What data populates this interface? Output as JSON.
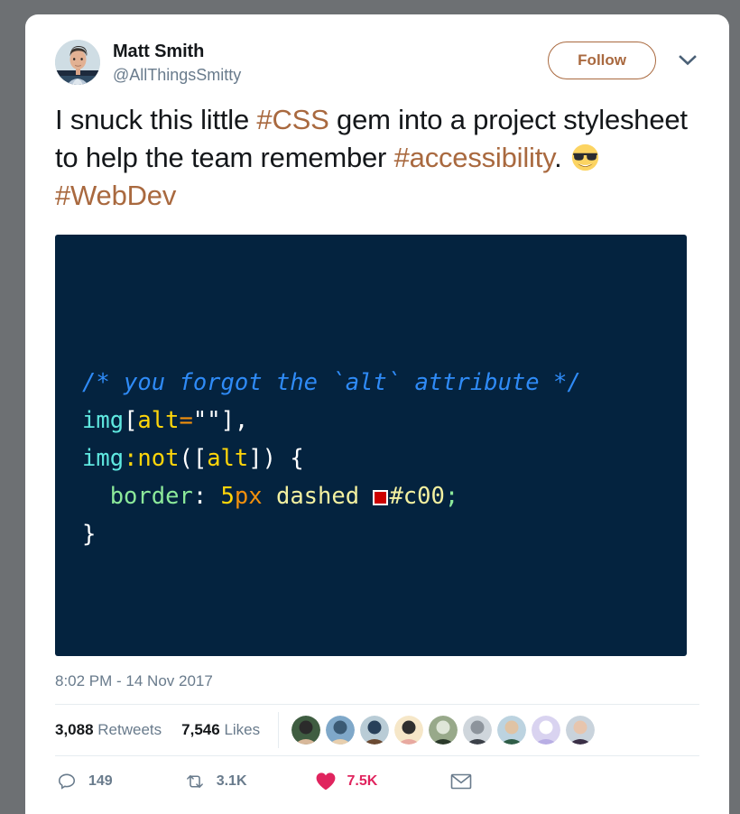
{
  "tweet": {
    "author": {
      "display_name": "Matt Smith",
      "handle": "@AllThingsSmitty",
      "avatar_icon": "user-avatar-photo"
    },
    "follow_button": {
      "label": "Follow",
      "color": "#a9693f"
    },
    "more_menu_icon": "chevron-down-icon",
    "text_parts": [
      {
        "text": "I snuck this little ",
        "type": "plain"
      },
      {
        "text": "#CSS",
        "type": "hashtag"
      },
      {
        "text": " gem into a project stylesheet to help the team remember ",
        "type": "plain"
      },
      {
        "text": "#accessibility",
        "type": "hashtag"
      },
      {
        "text": ". ",
        "type": "plain"
      },
      {
        "text": "😎",
        "type": "emoji",
        "name": "smiling-face-with-sunglasses"
      },
      {
        "text": " ",
        "type": "plain"
      },
      {
        "text": "#WebDev",
        "type": "hashtag"
      }
    ],
    "hashtag_color": "#a9693f",
    "code_image": {
      "background": "#04233f",
      "lines": [
        {
          "tokens": [
            {
              "t": "/* you forgot the `alt` attribute */",
              "c": "comment"
            }
          ]
        },
        {
          "tokens": [
            {
              "t": "img",
              "c": "tag"
            },
            {
              "t": "[",
              "c": "punct"
            },
            {
              "t": "alt",
              "c": "attr"
            },
            {
              "t": "=",
              "c": "op"
            },
            {
              "t": "\"\"",
              "c": "punct"
            },
            {
              "t": "]",
              "c": "punct"
            },
            {
              "t": ",",
              "c": "punct"
            }
          ]
        },
        {
          "tokens": [
            {
              "t": "img",
              "c": "tag"
            },
            {
              "t": ":not",
              "c": "attr"
            },
            {
              "t": "(",
              "c": "punct"
            },
            {
              "t": "[",
              "c": "punct"
            },
            {
              "t": "alt",
              "c": "attr"
            },
            {
              "t": "]",
              "c": "punct"
            },
            {
              "t": ")",
              "c": "punct"
            },
            {
              "t": " {",
              "c": "punct"
            }
          ]
        },
        {
          "tokens": [
            {
              "t": "  border",
              "c": "prop"
            },
            {
              "t": ": ",
              "c": "punct"
            },
            {
              "t": "5",
              "c": "num"
            },
            {
              "t": "px",
              "c": "unit"
            },
            {
              "t": " dashed ",
              "c": "val"
            },
            {
              "t": "■",
              "c": "swatch"
            },
            {
              "t": "#c00",
              "c": "val"
            },
            {
              "t": ";",
              "c": "semi"
            }
          ]
        },
        {
          "tokens": [
            {
              "t": "}",
              "c": "punct"
            }
          ]
        }
      ],
      "swatch_color": "#cc0000"
    },
    "timestamp": "8:02 PM - 14 Nov 2017",
    "stats": {
      "retweets_count": "3,088",
      "retweets_label": "Retweets",
      "likes_count": "7,546",
      "likes_label": "Likes",
      "liker_avatars": [
        "liker-avatar-1",
        "liker-avatar-2",
        "liker-avatar-3",
        "liker-avatar-4",
        "liker-avatar-5",
        "liker-avatar-6",
        "liker-avatar-7",
        "liker-avatar-8",
        "liker-avatar-9"
      ]
    },
    "actions": {
      "reply": {
        "icon": "reply-icon",
        "count": "149"
      },
      "retweet": {
        "icon": "retweet-icon",
        "count": "3.1K"
      },
      "like": {
        "icon": "heart-icon",
        "count": "7.5K",
        "color": "#e0245e"
      },
      "message": {
        "icon": "envelope-icon",
        "count": ""
      }
    }
  }
}
